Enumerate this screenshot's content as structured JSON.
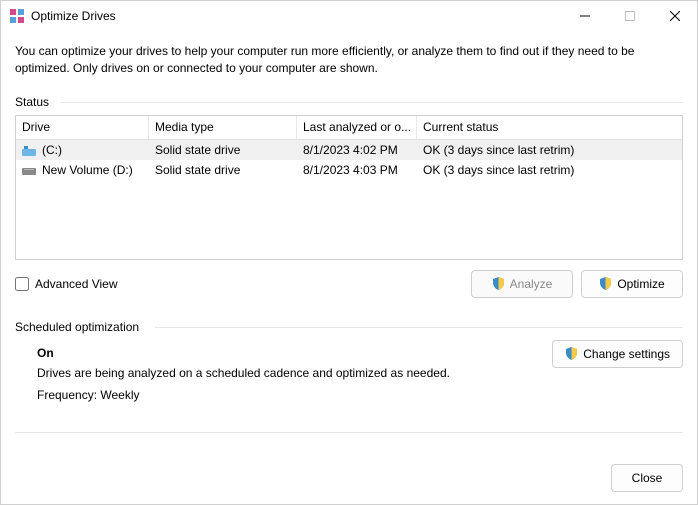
{
  "window": {
    "title": "Optimize Drives"
  },
  "intro": "You can optimize your drives to help your computer run more efficiently, or analyze them to find out if they need to be optimized. Only drives on or connected to your computer are shown.",
  "status_label": "Status",
  "table": {
    "headers": {
      "drive": "Drive",
      "media": "Media type",
      "last": "Last analyzed or o...",
      "status": "Current status"
    },
    "rows": [
      {
        "drive": "(C:)",
        "media": "Solid state drive",
        "last": "8/1/2023 4:02 PM",
        "status": "OK (3 days since last retrim)",
        "selected": true,
        "icon": "os-drive"
      },
      {
        "drive": "New Volume (D:)",
        "media": "Solid state drive",
        "last": "8/1/2023 4:03 PM",
        "status": "OK (3 days since last retrim)",
        "selected": false,
        "icon": "ssd-drive"
      }
    ]
  },
  "advanced_view": "Advanced View",
  "buttons": {
    "analyze": "Analyze",
    "optimize": "Optimize",
    "change_settings": "Change settings",
    "close": "Close"
  },
  "scheduled": {
    "label": "Scheduled optimization",
    "state": "On",
    "desc": "Drives are being analyzed on a scheduled cadence and optimized as needed.",
    "frequency": "Frequency: Weekly"
  }
}
